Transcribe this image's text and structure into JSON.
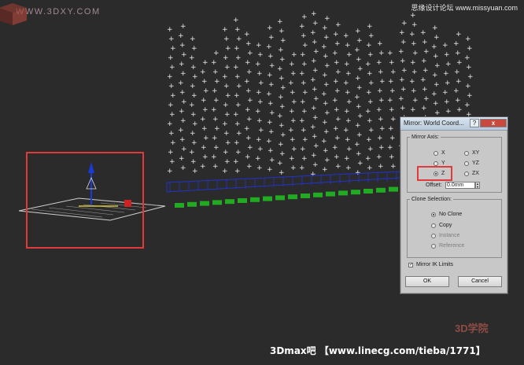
{
  "watermarks": {
    "top_left": "WWW.3DXY.COM",
    "top_right": "思缘设计论坛 www.missyuan.com",
    "bottom": "3Dmax吧 【www.linecg.com/tieba/1771】",
    "logo_text": "3D学院"
  },
  "dialog": {
    "title": "Mirror: World Coord...",
    "help_label": "?",
    "close_label": "x",
    "mirror_axis": {
      "label": "Mirror Axis:",
      "options": [
        "X",
        "Y",
        "Z",
        "XY",
        "YZ",
        "ZX"
      ],
      "selected": "Z",
      "offset_label": "Offset:",
      "offset_value": "0.0mm"
    },
    "clone_selection": {
      "label": "Clone Selection:",
      "options": [
        "No Clone",
        "Copy",
        "Instance",
        "Reference"
      ],
      "selected": "No Clone"
    },
    "mirror_ik": {
      "label": "Mirror IK Limits",
      "checked": true
    },
    "ok_label": "OK",
    "cancel_label": "Cancel"
  },
  "colors": {
    "highlight": "#e23a3a",
    "points": "#e8e8e8",
    "floor": "#22aa22",
    "grid": "#2233cc",
    "gizmo": "#1a3bd6"
  }
}
